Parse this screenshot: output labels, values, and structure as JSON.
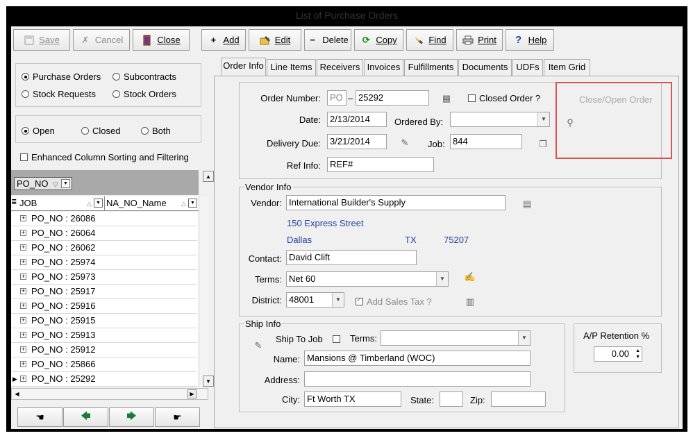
{
  "window": {
    "title": "List of Purchase Orders"
  },
  "toolbar": {
    "save": "Save",
    "cancel": "Cancel",
    "close": "Close",
    "add": "Add",
    "edit": "Edit",
    "delete": "Delete",
    "copy": "Copy",
    "find": "Find",
    "print": "Print",
    "help": "Help"
  },
  "left": {
    "type_options": [
      "Purchase Orders",
      "Subcontracts",
      "Stock Requests",
      "Stock Orders"
    ],
    "status_options": [
      "Open",
      "Closed",
      "Both"
    ],
    "enhanced_sort": "Enhanced Column Sorting and Filtering",
    "group_by": "PO_NO",
    "columns": [
      "JOB",
      "NA_NO_Name"
    ],
    "rows": [
      "PO_NO : 26086",
      "PO_NO : 26064",
      "PO_NO : 26062",
      "PO_NO : 25974",
      "PO_NO : 25973",
      "PO_NO : 25917",
      "PO_NO : 25916",
      "PO_NO : 25915",
      "PO_NO : 25913",
      "PO_NO : 25912",
      "PO_NO : 25866",
      "PO_NO : 25292"
    ]
  },
  "tabs": [
    "Order Info",
    "Line Items",
    "Receivers",
    "Invoices",
    "Fulfillments",
    "Documents",
    "UDFs",
    "Item Grid"
  ],
  "order": {
    "order_number_label": "Order Number:",
    "prefix": "PO",
    "dash": "–",
    "order_number": "25292",
    "closed_order_label": "Closed Order ?",
    "date_label": "Date:",
    "date": "2/13/2014",
    "ordered_by_label": "Ordered By:",
    "ordered_by": "",
    "delivery_due_label": "Delivery Due:",
    "delivery_due": "3/21/2014",
    "job_label": "Job:",
    "job": "844",
    "ref_info_label": "Ref Info:",
    "ref_info": "REF#",
    "close_open_label": "Close/Open Order"
  },
  "vendor": {
    "legend": "Vendor Info",
    "vendor_label": "Vendor:",
    "vendor": "International Builder's Supply",
    "street": "150 Express Street",
    "city": "Dallas",
    "state": "TX",
    "zip": "75207",
    "contact_label": "Contact:",
    "contact": "David Clift",
    "terms_label": "Terms:",
    "terms": "Net 60",
    "district_label": "District:",
    "district": "48001",
    "add_sales_tax": "Add Sales Tax ?"
  },
  "ship": {
    "legend": "Ship Info",
    "ship_to_job": "Ship To Job",
    "terms_label": "Terms:",
    "terms": "",
    "name_label": "Name:",
    "name": "Mansions @ Timberland (WOC)",
    "address_label": "Address:",
    "address": "",
    "city_label": "City:",
    "city": "Ft Worth TX",
    "state_label": "State:",
    "state": "",
    "zip_label": "Zip:",
    "zip": ""
  },
  "retention": {
    "label": "A/P Retention %",
    "value": "0.00"
  },
  "colors": {
    "highlight": "#d9534f",
    "link_blue": "#1f3f9f",
    "disabled": "#8a8a8a"
  }
}
